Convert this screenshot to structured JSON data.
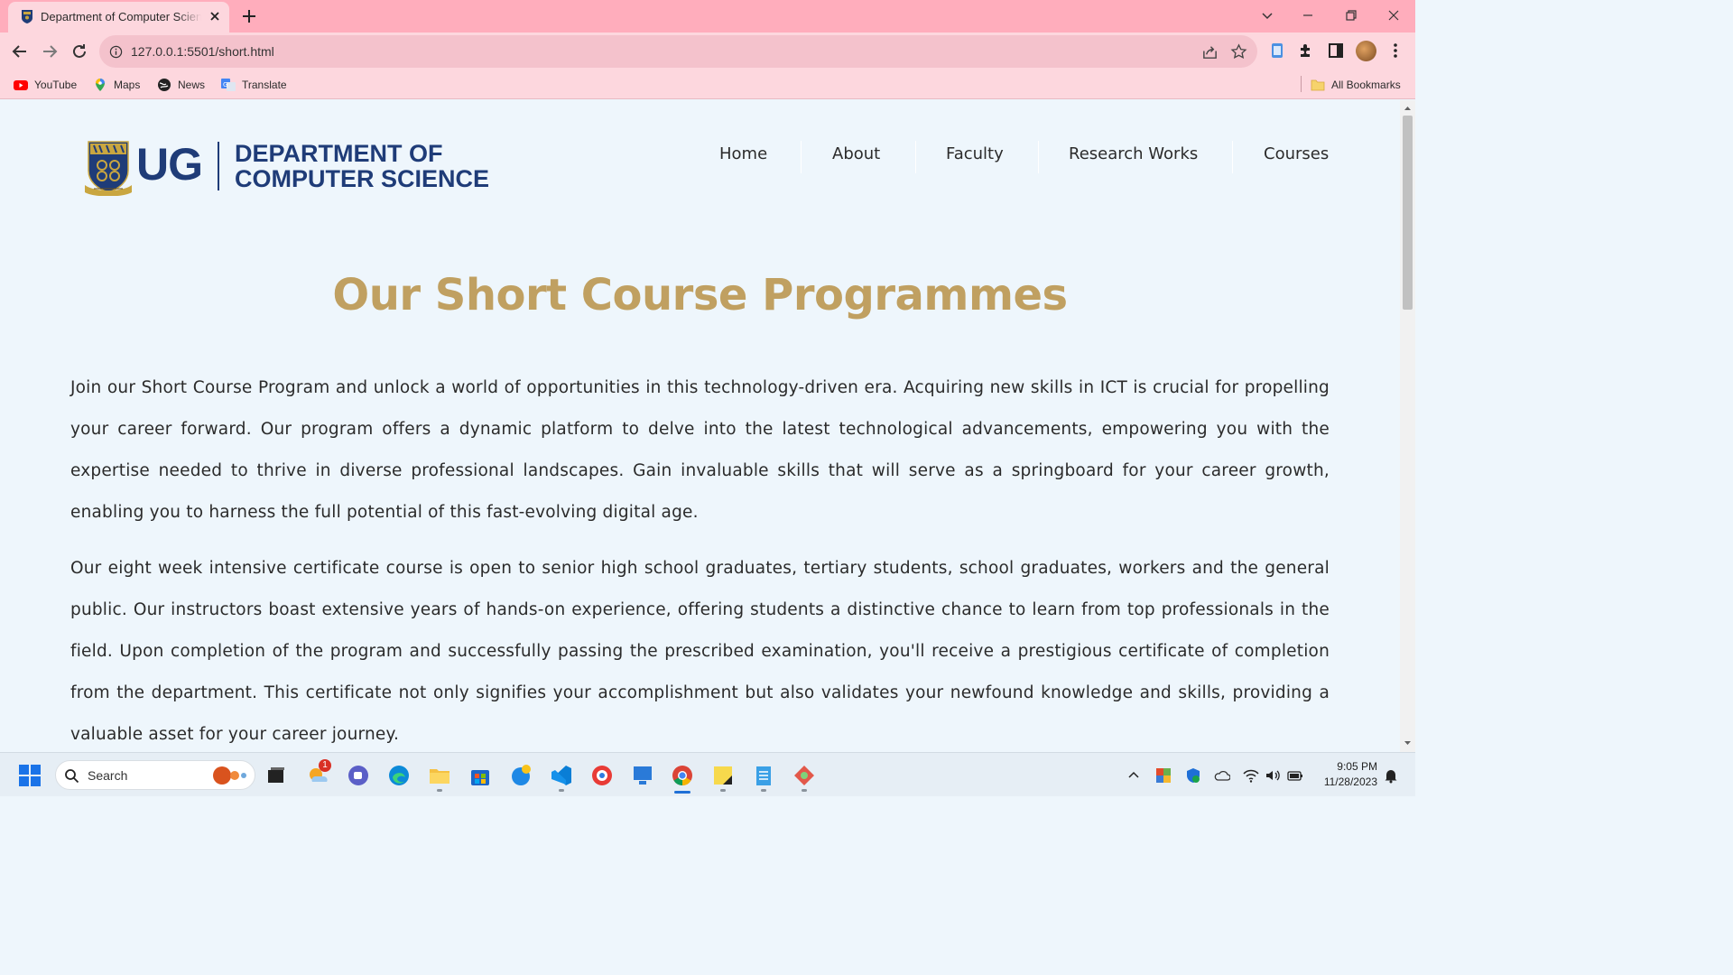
{
  "browser": {
    "tab_title": "Department of Computer Science",
    "url": "127.0.0.1:5501/short.html",
    "bookmarks": [
      {
        "label": "YouTube",
        "icon": "youtube-icon"
      },
      {
        "label": "Maps",
        "icon": "maps-icon"
      },
      {
        "label": "News",
        "icon": "news-icon"
      },
      {
        "label": "Translate",
        "icon": "translate-icon"
      }
    ],
    "all_bookmarks_label": "All Bookmarks"
  },
  "site": {
    "logo_ug": "UG",
    "logo_dept_line1": "DEPARTMENT OF",
    "logo_dept_line2": "COMPUTER SCIENCE",
    "nav": [
      "Home",
      "About",
      "Faculty",
      "Research Works",
      "Courses"
    ]
  },
  "content": {
    "heading": "Our Short Course Programmes",
    "paragraph1": "Join our Short Course Program and unlock a world of opportunities in this technology-driven era. Acquiring new skills in ICT is crucial for propelling your career forward. Our program offers a dynamic platform to delve into the latest technological advancements, empowering you with the expertise needed to thrive in diverse professional landscapes. Gain invaluable skills that will serve as a springboard for your career growth, enabling you to harness the full potential of this fast-evolving digital age.",
    "paragraph2": "Our eight week intensive certificate course is open to senior high school graduates, tertiary students, school graduates, workers and the general public. Our instructors boast extensive years of hands-on experience, offering students a distinctive chance to learn from top professionals in the field. Upon completion of the program and successfully passing the prescribed examination, you'll receive a prestigious certificate of completion from the department. This certificate not only signifies your accomplishment but also validates your newfound knowledge and skills, providing a valuable asset for your career journey."
  },
  "taskbar": {
    "search_placeholder": "Search",
    "badge_count": "1",
    "time": "9:05 PM",
    "date": "11/28/2023"
  },
  "colors": {
    "brand_navy": "#1f3c78",
    "heading_gold": "#c0a061",
    "page_bg": "#eef6fc",
    "chrome_pink": "#ffadbc"
  }
}
